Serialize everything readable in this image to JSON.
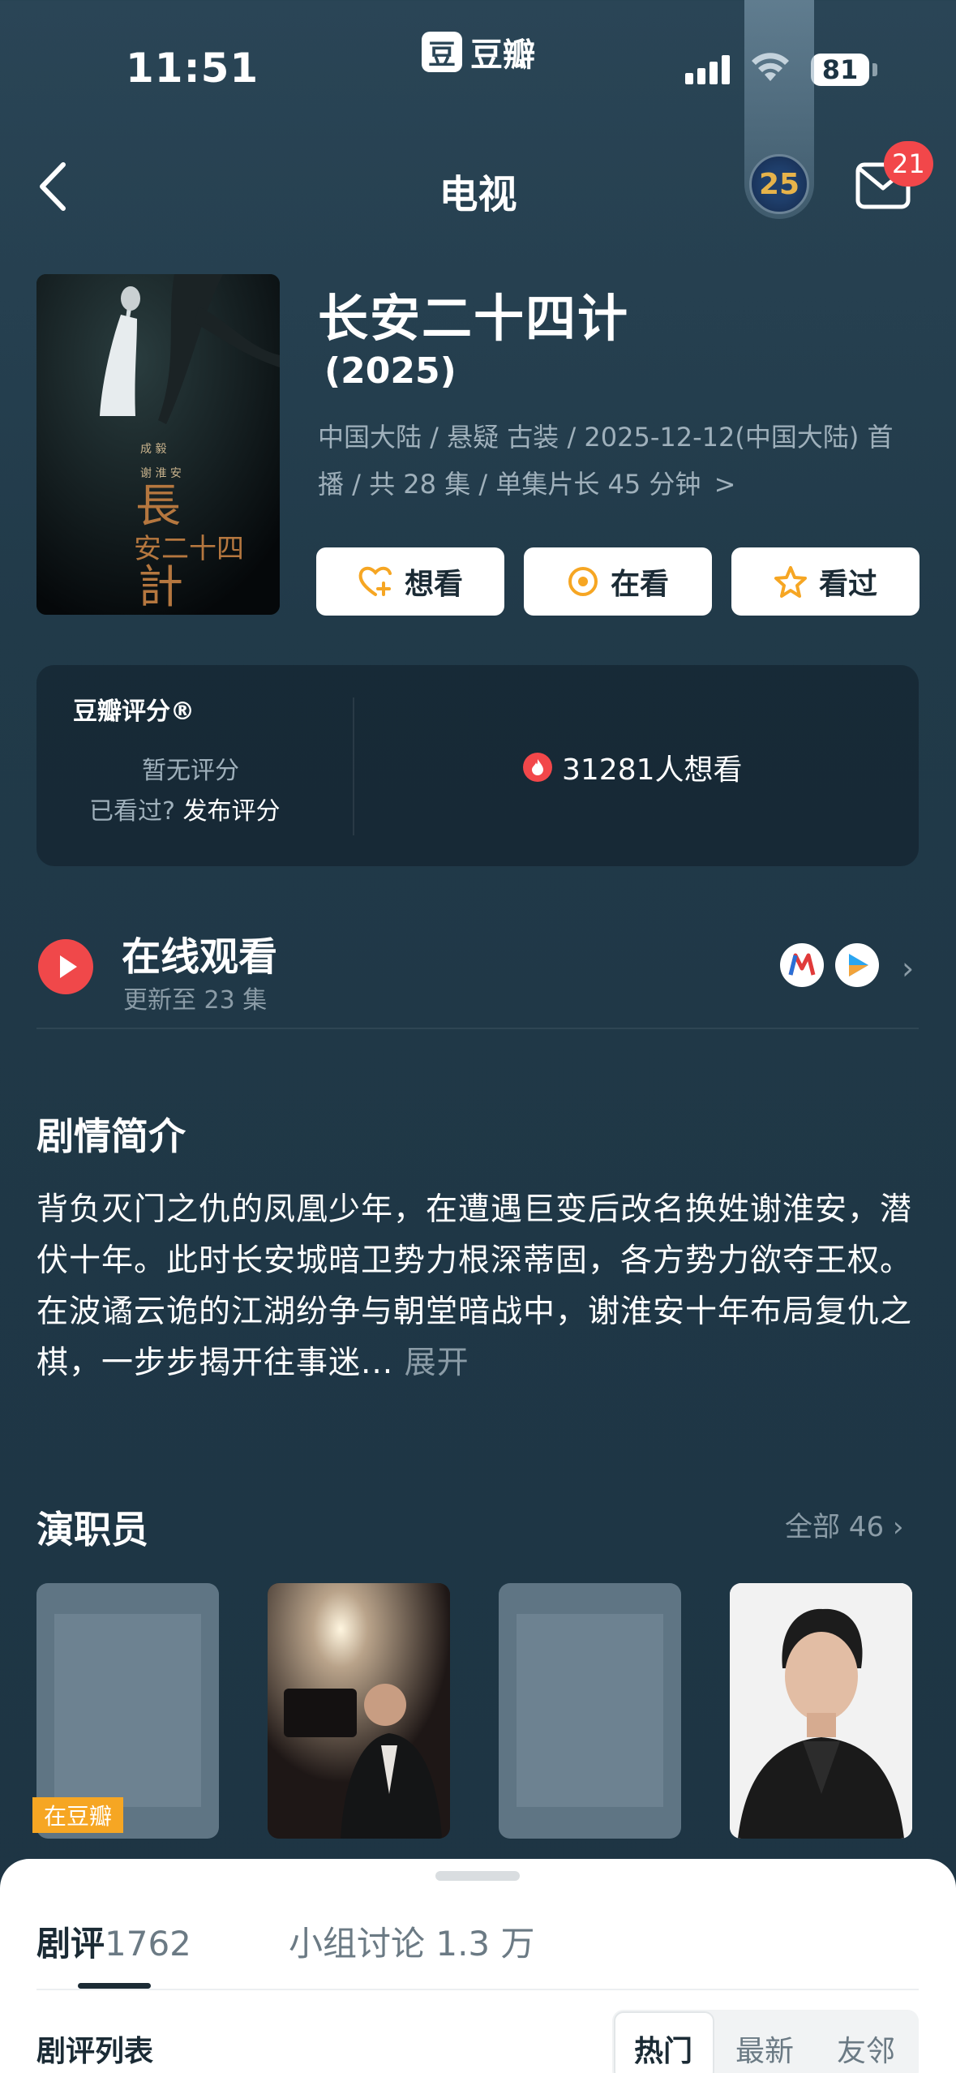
{
  "status_bar": {
    "time": "11:51",
    "brand_logo": "豆",
    "brand_name": "豆瓣",
    "battery": "81"
  },
  "profile_badge": "25",
  "nav": {
    "title": "电视",
    "mail_badge": "21"
  },
  "show": {
    "title": "长安二十四计",
    "year": "(2025)",
    "meta_line1": "中国大陆 / 悬疑 古装 / 2025-12-12(中国大陆) 首",
    "meta_line2": "播 / 共 28 集 / 单集片长 45 分钟",
    "meta_chevron": ">"
  },
  "actions": [
    {
      "label": "想看",
      "icon": "heart-plus-icon"
    },
    {
      "label": "在看",
      "icon": "target-circle-icon"
    },
    {
      "label": "看过",
      "icon": "star-icon"
    }
  ],
  "rating": {
    "title": "豆瓣评分®",
    "no_rating": "暂无评分",
    "seen_prompt": "已看过?",
    "publish_label": "发布评分",
    "want_count": "31281人想看"
  },
  "online": {
    "title": "在线观看",
    "subtitle": "更新至 23 集"
  },
  "synopsis": {
    "title": "剧情简介",
    "text": "背负灭门之仇的凤凰少年，在遭遇巨变后改名换姓谢淮安，潜伏十年。此时长安城暗卫势力根深蒂固，各方势力欲夺王权。在波谲云诡的江湖纷争与朝堂暗战中，谢淮安十年布局复仇之棋，一步步揭开往事迷...",
    "more": "展开"
  },
  "cast": {
    "title": "演职员",
    "all_label": "全部 46",
    "tag": "在豆瓣"
  },
  "sheet": {
    "tab_reviews_label": "剧评",
    "tab_reviews_count": "1762",
    "tab_group": "小组讨论 1.3 万",
    "list_title": "剧评列表",
    "segments": [
      "热门",
      "最新",
      "友邻"
    ]
  },
  "colors": {
    "accent_red": "#f2474a",
    "action_orange": "#f6a623",
    "background": "#213a49"
  }
}
